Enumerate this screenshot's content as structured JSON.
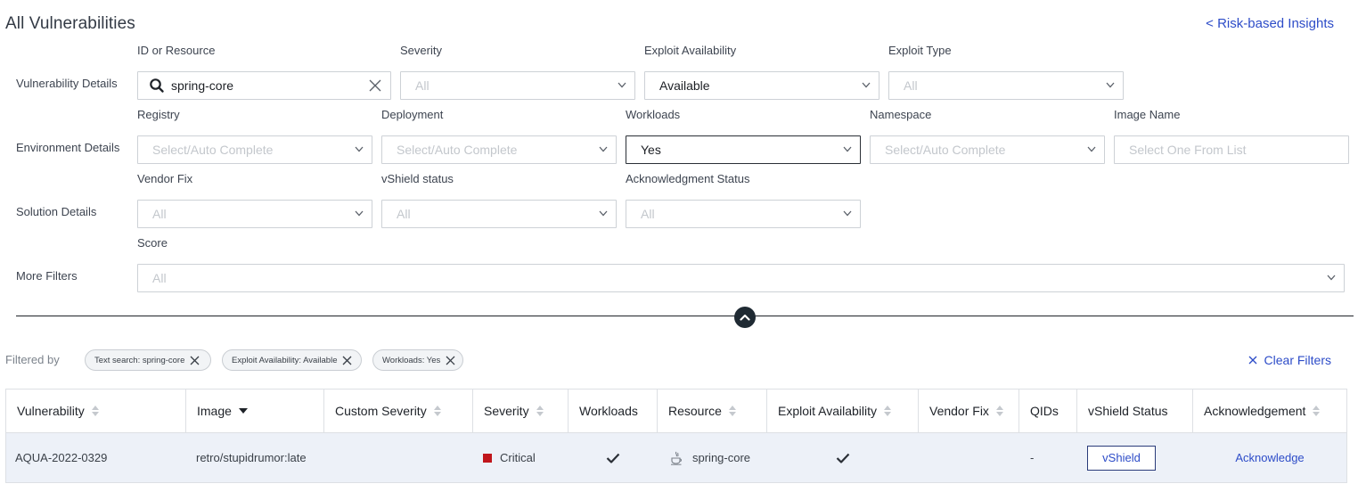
{
  "header": {
    "title": "All Vulnerabilities",
    "back_link": "< Risk-based Insights"
  },
  "rows": {
    "vulnerability_details": "Vulnerability Details",
    "environment_details": "Environment Details",
    "solution_details": "Solution Details",
    "more_filters": "More Filters"
  },
  "filters": {
    "id_resource": {
      "label": "ID or Resource",
      "value": "spring-core"
    },
    "severity": {
      "label": "Severity",
      "value": "All"
    },
    "exploit_availability": {
      "label": "Exploit Availability",
      "value": "Available"
    },
    "exploit_type": {
      "label": "Exploit Type",
      "value": "All"
    },
    "registry": {
      "label": "Registry",
      "placeholder": "Select/Auto Complete"
    },
    "deployment": {
      "label": "Deployment",
      "placeholder": "Select/Auto Complete"
    },
    "workloads": {
      "label": "Workloads",
      "value": "Yes"
    },
    "namespace": {
      "label": "Namespace",
      "placeholder": "Select/Auto Complete"
    },
    "image_name": {
      "label": "Image Name",
      "placeholder": "Select One From List"
    },
    "vendor_fix": {
      "label": "Vendor Fix",
      "value": "All"
    },
    "vshield_status": {
      "label": "vShield status",
      "value": "All"
    },
    "ack_status": {
      "label": "Acknowledgment Status",
      "value": "All"
    },
    "score": {
      "label": "Score",
      "value": "All"
    }
  },
  "active_filters": {
    "label": "Filtered by",
    "chips": [
      "Text search: spring-core",
      "Exploit Availability: Available",
      "Workloads: Yes"
    ],
    "clear_label": "Clear Filters"
  },
  "table": {
    "columns": [
      "Vulnerability",
      "Image",
      "Custom Severity",
      "Severity",
      "Workloads",
      "Resource",
      "Exploit Availability",
      "Vendor Fix",
      "QIDs",
      "vShield Status",
      "Acknowledgement"
    ],
    "rows": [
      {
        "vulnerability": "AQUA-2022-0329",
        "image": "retro/stupidrumor:late",
        "custom_severity": "",
        "severity": "Critical",
        "severity_color": "#c0161c",
        "workloads": true,
        "resource_icon": "java-icon",
        "resource": "spring-core",
        "exploit_availability": true,
        "vendor_fix": "",
        "qids": "-",
        "vshield_label": "vShield",
        "ack_label": "Acknowledge"
      }
    ]
  },
  "colors": {
    "accent": "#2d4cc8",
    "critical": "#c0161c",
    "row_highlight": "#edf1f8"
  }
}
